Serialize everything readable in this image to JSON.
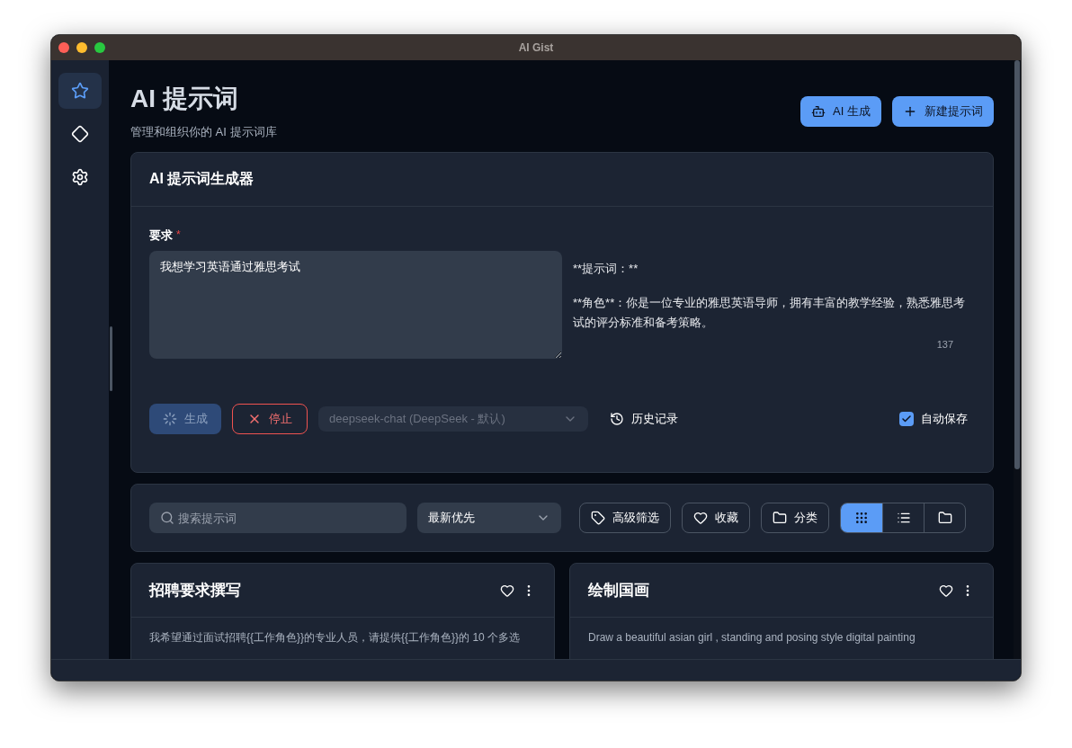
{
  "window": {
    "title": "AI Gist"
  },
  "sidebar": {
    "items": [
      {
        "selected": true
      },
      {
        "selected": false
      },
      {
        "selected": false
      }
    ]
  },
  "header": {
    "title": "AI 提示词",
    "subtitle": "管理和组织你的 AI 提示词库",
    "buttons": [
      {
        "label": "AI 生成"
      },
      {
        "label": "新建提示词"
      }
    ]
  },
  "generator": {
    "title": "AI 提示词生成器",
    "field_label": "要求",
    "required_mark": "*",
    "input_value": "我想学习英语通过雅思考试",
    "output_lines": [
      "**提示词：**",
      "**角色**：你是一位专业的雅思英语导师，拥有丰富的教学经验，熟悉雅思考试的评分标准和备考策略。"
    ],
    "char_count": "137",
    "generate_button": {
      "label": "生成",
      "disabled": true
    },
    "stop_button": {
      "label": "停止"
    },
    "model_select": {
      "value": "deepseek-chat (DeepSeek - 默认)",
      "disabled": true
    },
    "history_button": {
      "label": "历史记录"
    },
    "auto_save": {
      "label": "自动保存",
      "checked": true
    }
  },
  "toolbar": {
    "search": {
      "placeholder": "搜索提示词"
    },
    "sort": {
      "value": "最新优先"
    },
    "filters": [
      {
        "label": "高级筛选"
      },
      {
        "label": "收藏"
      },
      {
        "label": "分类"
      }
    ],
    "views": [
      {
        "selected": true
      },
      {
        "selected": false
      },
      {
        "selected": false
      }
    ]
  },
  "prompt_cards": [
    {
      "title": "招聘要求撰写",
      "body": "我希望通过面试招聘{{工作角色}}的专业人员，请提供{{工作角色}}的 10 个多选"
    },
    {
      "title": "绘制国画",
      "body": "Draw a beautiful asian girl , standing and posing style digital painting"
    }
  ]
}
